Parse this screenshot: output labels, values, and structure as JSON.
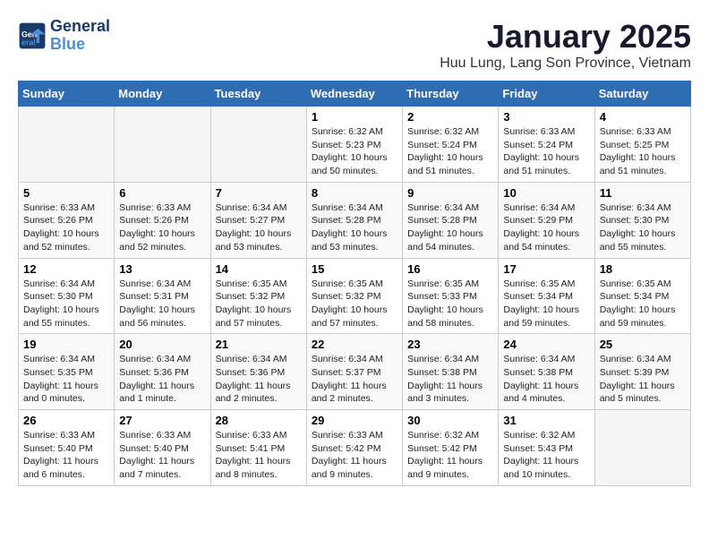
{
  "header": {
    "logo_line1": "General",
    "logo_line2": "Blue",
    "title": "January 2025",
    "subtitle": "Huu Lung, Lang Son Province, Vietnam"
  },
  "weekdays": [
    "Sunday",
    "Monday",
    "Tuesday",
    "Wednesday",
    "Thursday",
    "Friday",
    "Saturday"
  ],
  "weeks": [
    [
      {
        "day": "",
        "info": ""
      },
      {
        "day": "",
        "info": ""
      },
      {
        "day": "",
        "info": ""
      },
      {
        "day": "1",
        "info": "Sunrise: 6:32 AM\nSunset: 5:23 PM\nDaylight: 10 hours\nand 50 minutes."
      },
      {
        "day": "2",
        "info": "Sunrise: 6:32 AM\nSunset: 5:24 PM\nDaylight: 10 hours\nand 51 minutes."
      },
      {
        "day": "3",
        "info": "Sunrise: 6:33 AM\nSunset: 5:24 PM\nDaylight: 10 hours\nand 51 minutes."
      },
      {
        "day": "4",
        "info": "Sunrise: 6:33 AM\nSunset: 5:25 PM\nDaylight: 10 hours\nand 51 minutes."
      }
    ],
    [
      {
        "day": "5",
        "info": "Sunrise: 6:33 AM\nSunset: 5:26 PM\nDaylight: 10 hours\nand 52 minutes."
      },
      {
        "day": "6",
        "info": "Sunrise: 6:33 AM\nSunset: 5:26 PM\nDaylight: 10 hours\nand 52 minutes."
      },
      {
        "day": "7",
        "info": "Sunrise: 6:34 AM\nSunset: 5:27 PM\nDaylight: 10 hours\nand 53 minutes."
      },
      {
        "day": "8",
        "info": "Sunrise: 6:34 AM\nSunset: 5:28 PM\nDaylight: 10 hours\nand 53 minutes."
      },
      {
        "day": "9",
        "info": "Sunrise: 6:34 AM\nSunset: 5:28 PM\nDaylight: 10 hours\nand 54 minutes."
      },
      {
        "day": "10",
        "info": "Sunrise: 6:34 AM\nSunset: 5:29 PM\nDaylight: 10 hours\nand 54 minutes."
      },
      {
        "day": "11",
        "info": "Sunrise: 6:34 AM\nSunset: 5:30 PM\nDaylight: 10 hours\nand 55 minutes."
      }
    ],
    [
      {
        "day": "12",
        "info": "Sunrise: 6:34 AM\nSunset: 5:30 PM\nDaylight: 10 hours\nand 55 minutes."
      },
      {
        "day": "13",
        "info": "Sunrise: 6:34 AM\nSunset: 5:31 PM\nDaylight: 10 hours\nand 56 minutes."
      },
      {
        "day": "14",
        "info": "Sunrise: 6:35 AM\nSunset: 5:32 PM\nDaylight: 10 hours\nand 57 minutes."
      },
      {
        "day": "15",
        "info": "Sunrise: 6:35 AM\nSunset: 5:32 PM\nDaylight: 10 hours\nand 57 minutes."
      },
      {
        "day": "16",
        "info": "Sunrise: 6:35 AM\nSunset: 5:33 PM\nDaylight: 10 hours\nand 58 minutes."
      },
      {
        "day": "17",
        "info": "Sunrise: 6:35 AM\nSunset: 5:34 PM\nDaylight: 10 hours\nand 59 minutes."
      },
      {
        "day": "18",
        "info": "Sunrise: 6:35 AM\nSunset: 5:34 PM\nDaylight: 10 hours\nand 59 minutes."
      }
    ],
    [
      {
        "day": "19",
        "info": "Sunrise: 6:34 AM\nSunset: 5:35 PM\nDaylight: 11 hours\nand 0 minutes."
      },
      {
        "day": "20",
        "info": "Sunrise: 6:34 AM\nSunset: 5:36 PM\nDaylight: 11 hours\nand 1 minute."
      },
      {
        "day": "21",
        "info": "Sunrise: 6:34 AM\nSunset: 5:36 PM\nDaylight: 11 hours\nand 2 minutes."
      },
      {
        "day": "22",
        "info": "Sunrise: 6:34 AM\nSunset: 5:37 PM\nDaylight: 11 hours\nand 2 minutes."
      },
      {
        "day": "23",
        "info": "Sunrise: 6:34 AM\nSunset: 5:38 PM\nDaylight: 11 hours\nand 3 minutes."
      },
      {
        "day": "24",
        "info": "Sunrise: 6:34 AM\nSunset: 5:38 PM\nDaylight: 11 hours\nand 4 minutes."
      },
      {
        "day": "25",
        "info": "Sunrise: 6:34 AM\nSunset: 5:39 PM\nDaylight: 11 hours\nand 5 minutes."
      }
    ],
    [
      {
        "day": "26",
        "info": "Sunrise: 6:33 AM\nSunset: 5:40 PM\nDaylight: 11 hours\nand 6 minutes."
      },
      {
        "day": "27",
        "info": "Sunrise: 6:33 AM\nSunset: 5:40 PM\nDaylight: 11 hours\nand 7 minutes."
      },
      {
        "day": "28",
        "info": "Sunrise: 6:33 AM\nSunset: 5:41 PM\nDaylight: 11 hours\nand 8 minutes."
      },
      {
        "day": "29",
        "info": "Sunrise: 6:33 AM\nSunset: 5:42 PM\nDaylight: 11 hours\nand 9 minutes."
      },
      {
        "day": "30",
        "info": "Sunrise: 6:32 AM\nSunset: 5:42 PM\nDaylight: 11 hours\nand 9 minutes."
      },
      {
        "day": "31",
        "info": "Sunrise: 6:32 AM\nSunset: 5:43 PM\nDaylight: 11 hours\nand 10 minutes."
      },
      {
        "day": "",
        "info": ""
      }
    ]
  ]
}
